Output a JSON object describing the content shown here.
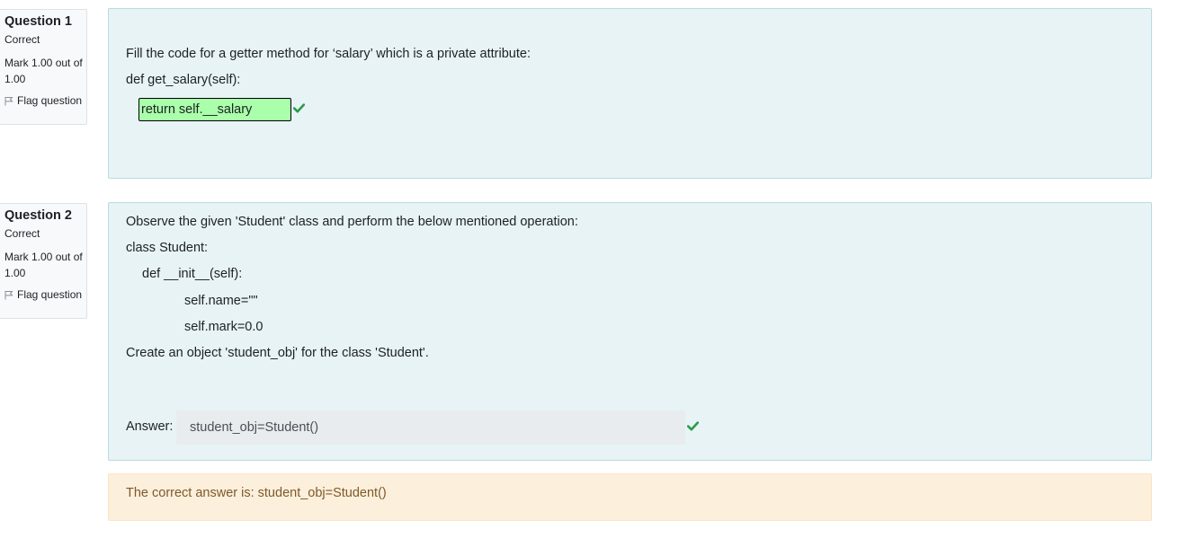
{
  "questions": [
    {
      "title": "Question 1",
      "state": "Correct",
      "grade": "Mark 1.00 out of 1.00",
      "flag_label": "Flag question",
      "text_lines": [
        "Fill the code for a getter method for ‘salary’ which is a private attribute:",
        "def get_salary(self):"
      ],
      "answer_value": "return self.__salary",
      "answer_result": "correct"
    },
    {
      "title": "Question 2",
      "state": "Correct",
      "grade": "Mark 1.00 out of 1.00",
      "flag_label": "Flag question",
      "text_lines": [
        "Observe the given 'Student' class and perform the below mentioned operation:",
        "class Student:",
        "def __init__(self):",
        "self.name=\"\"",
        "self.mark=0.0",
        "Create an object 'student_obj' for the class 'Student'."
      ],
      "answer_label": "Answer:",
      "answer_value": "student_obj=Student()",
      "answer_result": "correct",
      "feedback": "The correct answer is: student_obj=Student()"
    }
  ],
  "colors": {
    "correct_green": "#2b9a4a",
    "question_bg": "#e7f3f5",
    "feedback_bg": "#fcefdc",
    "feedback_text": "#7d5a29",
    "correct_input_bg": "#aaffaa"
  }
}
